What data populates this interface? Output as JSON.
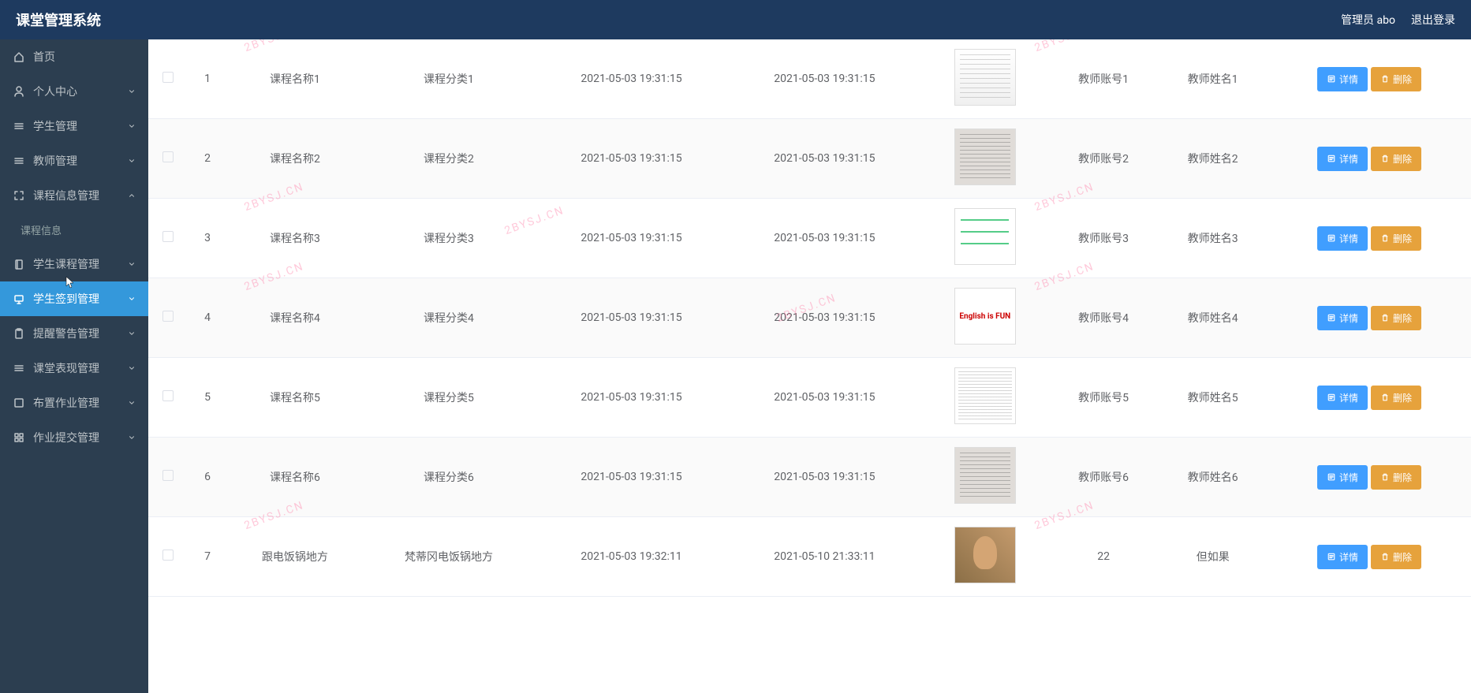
{
  "header": {
    "title": "课堂管理系统",
    "admin_label": "管理员 abo",
    "logout_label": "退出登录"
  },
  "sidebar": {
    "items": [
      {
        "label": "首页",
        "icon": "home"
      },
      {
        "label": "个人中心",
        "icon": "user",
        "expandable": true
      },
      {
        "label": "学生管理",
        "icon": "list",
        "expandable": true
      },
      {
        "label": "教师管理",
        "icon": "list",
        "expandable": true
      },
      {
        "label": "课程信息管理",
        "icon": "expand",
        "expandable": true,
        "expanded": true
      },
      {
        "label": "课程信息",
        "sub": true
      },
      {
        "label": "学生课程管理",
        "icon": "book",
        "expandable": true
      },
      {
        "label": "学生签到管理",
        "icon": "monitor",
        "expandable": true,
        "active": true
      },
      {
        "label": "提醒警告管理",
        "icon": "clipboard",
        "expandable": true
      },
      {
        "label": "课堂表现管理",
        "icon": "list",
        "expandable": true
      },
      {
        "label": "布置作业管理",
        "icon": "square",
        "expandable": true
      },
      {
        "label": "作业提交管理",
        "icon": "grid",
        "expandable": true
      }
    ]
  },
  "table": {
    "detail_label": "详情",
    "delete_label": "删除",
    "rows": [
      {
        "idx": "1",
        "name": "课程名称1",
        "category": "课程分类1",
        "t1": "2021-05-03 19:31:15",
        "t2": "2021-05-03 19:31:15",
        "thumb": "doc",
        "teacher_id": "教师账号1",
        "teacher_name": "教师姓名1"
      },
      {
        "idx": "2",
        "name": "课程名称2",
        "category": "课程分类2",
        "t1": "2021-05-03 19:31:15",
        "t2": "2021-05-03 19:31:15",
        "thumb": "text",
        "teacher_id": "教师账号2",
        "teacher_name": "教师姓名2"
      },
      {
        "idx": "3",
        "name": "课程名称3",
        "category": "课程分类3",
        "t1": "2021-05-03 19:31:15",
        "t2": "2021-05-03 19:31:15",
        "thumb": "diagram",
        "teacher_id": "教师账号3",
        "teacher_name": "教师姓名3"
      },
      {
        "idx": "4",
        "name": "课程名称4",
        "category": "课程分类4",
        "t1": "2021-05-03 19:31:15",
        "t2": "2021-05-03 19:31:15",
        "thumb": "fun",
        "teacher_id": "教师账号4",
        "teacher_name": "教师姓名4"
      },
      {
        "idx": "5",
        "name": "课程名称5",
        "category": "课程分类5",
        "t1": "2021-05-03 19:31:15",
        "t2": "2021-05-03 19:31:15",
        "thumb": "text2",
        "teacher_id": "教师账号5",
        "teacher_name": "教师姓名5"
      },
      {
        "idx": "6",
        "name": "课程名称6",
        "category": "课程分类6",
        "t1": "2021-05-03 19:31:15",
        "t2": "2021-05-03 19:31:15",
        "thumb": "text",
        "teacher_id": "教师账号6",
        "teacher_name": "教师姓名6"
      },
      {
        "idx": "7",
        "name": "跟电饭锅地方",
        "category": "梵蒂冈电饭锅地方",
        "t1": "2021-05-03 19:32:11",
        "t2": "2021-05-10 21:33:11",
        "thumb": "photo",
        "teacher_id": "22",
        "teacher_name": "但如果"
      }
    ]
  },
  "watermark": "2BYSJ.CN"
}
